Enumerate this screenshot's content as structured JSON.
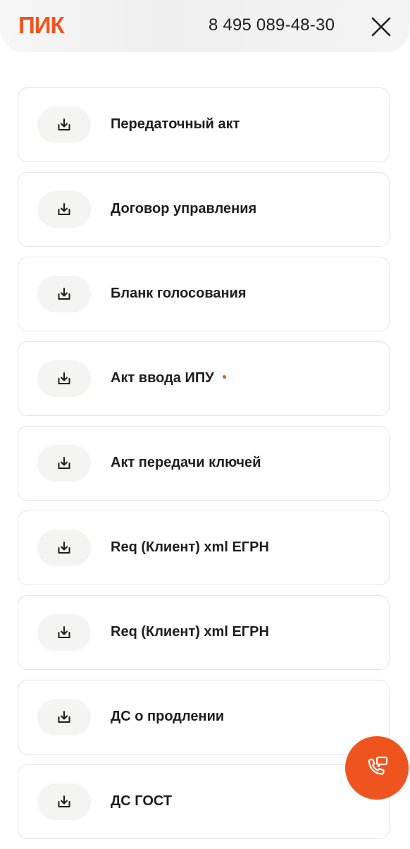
{
  "header": {
    "logo_text": "ПИК",
    "phone": "8 495 089-48-30",
    "close_icon": "close-icon"
  },
  "documents": [
    {
      "label": "Передаточный акт",
      "icon": "download-icon",
      "has_dot": false
    },
    {
      "label": "Договор управления",
      "icon": "download-icon",
      "has_dot": false
    },
    {
      "label": "Бланк голосования",
      "icon": "download-icon",
      "has_dot": false
    },
    {
      "label": "Акт ввода ИПУ",
      "icon": "download-icon",
      "has_dot": true
    },
    {
      "label": "Акт передачи ключей",
      "icon": "download-icon",
      "has_dot": false
    },
    {
      "label": "Req (Клиент) xml ЕГРН",
      "icon": "download-icon",
      "has_dot": false
    },
    {
      "label": "Req (Клиент) xml ЕГРН",
      "icon": "download-icon",
      "has_dot": false
    },
    {
      "label": "ДС о продлении",
      "icon": "download-icon",
      "has_dot": false
    },
    {
      "label": "ДС ГОСТ",
      "icon": "download-icon",
      "has_dot": false
    }
  ],
  "fab": {
    "icon": "phone-chat-icon"
  },
  "colors": {
    "brand": "#f0541e",
    "text": "#1e1e1e",
    "card_border": "#e4e4e4",
    "icon_bg": "#f4f4f3"
  }
}
